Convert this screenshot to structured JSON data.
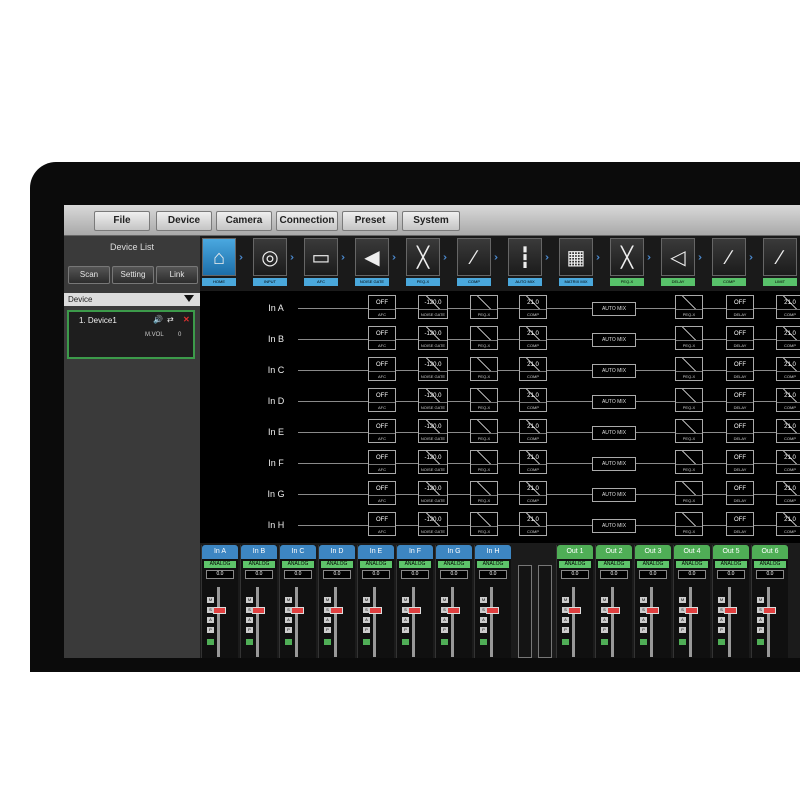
{
  "menu": [
    "File",
    "Device",
    "Camera",
    "Connection",
    "Preset",
    "System"
  ],
  "left_panel": {
    "title": "Device List",
    "buttons": [
      "Scan",
      "Setting",
      "Link"
    ],
    "dropdown_label": "Device",
    "device": {
      "name": "1. Device1",
      "mvol_label": "M.VOL",
      "mvol_value": "0"
    }
  },
  "chain": [
    {
      "label": "HOME",
      "icon": "home-icon",
      "color": "blue"
    },
    {
      "label": "INPUT",
      "icon": "xlr-input-icon",
      "color": "blue"
    },
    {
      "label": "AFC",
      "icon": "afc-icon",
      "color": "blue"
    },
    {
      "label": "NOISE GATE",
      "icon": "speaker-gate-icon",
      "color": "blue"
    },
    {
      "label": "PEQ-X",
      "icon": "peq-curve-icon",
      "color": "blue"
    },
    {
      "label": "COMP",
      "icon": "compressor-curve-icon",
      "color": "blue"
    },
    {
      "label": "AUTO MIX",
      "icon": "fader-bank-icon",
      "color": "blue"
    },
    {
      "label": "MATRIX MIX",
      "icon": "matrix-grid-icon",
      "color": "blue"
    },
    {
      "label": "PEQ-X",
      "icon": "peq-curve-icon",
      "color": "green"
    },
    {
      "label": "DELAY",
      "icon": "delay-speaker-icon",
      "color": "green"
    },
    {
      "label": "COMP",
      "icon": "compressor-curve-icon",
      "color": "green"
    },
    {
      "label": "LIMIT",
      "icon": "limiter-curve-icon",
      "color": "green"
    }
  ],
  "rows": [
    "In A",
    "In B",
    "In C",
    "In D",
    "In E",
    "In F",
    "In G",
    "In H"
  ],
  "blocks": {
    "afc_value": "OFF",
    "afc_label": "AFC",
    "gate_value": "-120.0",
    "gate_label": "NOISE GATE",
    "peq_label": "PEQ-X",
    "comp_value": "21.0",
    "comp_label": "COMP",
    "automix_label": "AUTO MIX",
    "delay_value": "OFF",
    "delay_label": "DELAY",
    "limit_value": "21.0",
    "limit_label": "LIMIT"
  },
  "mixer": {
    "inputs": [
      "In A",
      "In B",
      "In C",
      "In D",
      "In E",
      "In F",
      "In G",
      "In H"
    ],
    "outputs": [
      "Out 1",
      "Out 2",
      "Out 3",
      "Out 4",
      "Out 5",
      "Out 6"
    ],
    "source_label": "ANALOG",
    "level_value": "0.0"
  },
  "colors": {
    "input_accent": "#3d86c2",
    "output_accent": "#4fae56",
    "fader_knob": "#e04040"
  }
}
